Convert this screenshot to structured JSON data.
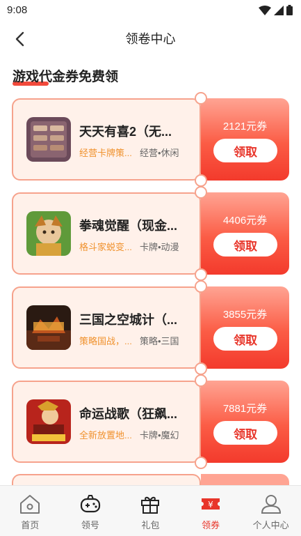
{
  "status_bar": {
    "time": "9:08"
  },
  "header": {
    "title": "领卷中心"
  },
  "section": {
    "title": "游戏代金券免费领"
  },
  "vouchers": [
    {
      "name": "天天有喜2（无...",
      "desc": "经营卡牌策...",
      "tags": "经营•休闲",
      "amount": "2121元券",
      "claim_label": "领取"
    },
    {
      "name": "拳魂觉醒（现金...",
      "desc": "格斗家蜕变...",
      "tags": "卡牌•动漫",
      "amount": "4406元券",
      "claim_label": "领取"
    },
    {
      "name": "三国之空城计（...",
      "desc": "策略国战，...",
      "tags": "策略•三国",
      "amount": "3855元券",
      "claim_label": "领取"
    },
    {
      "name": "命运战歌（狂飙...",
      "desc": "全新放置地...",
      "tags": "卡牌•魔幻",
      "amount": "7881元券",
      "claim_label": "领取"
    }
  ],
  "tabbar": {
    "items": [
      {
        "label": "首页",
        "icon": "home-icon"
      },
      {
        "label": "领号",
        "icon": "gamepad-icon"
      },
      {
        "label": "礼包",
        "icon": "gift-icon"
      },
      {
        "label": "领券",
        "icon": "coupon-icon",
        "active": true
      },
      {
        "label": "个人中心",
        "icon": "user-icon"
      }
    ]
  },
  "colors": {
    "accent": "#e8352a",
    "card_bg": "#fff1ea",
    "card_border": "#f6a28c",
    "desc_orange": "#f0922e"
  }
}
